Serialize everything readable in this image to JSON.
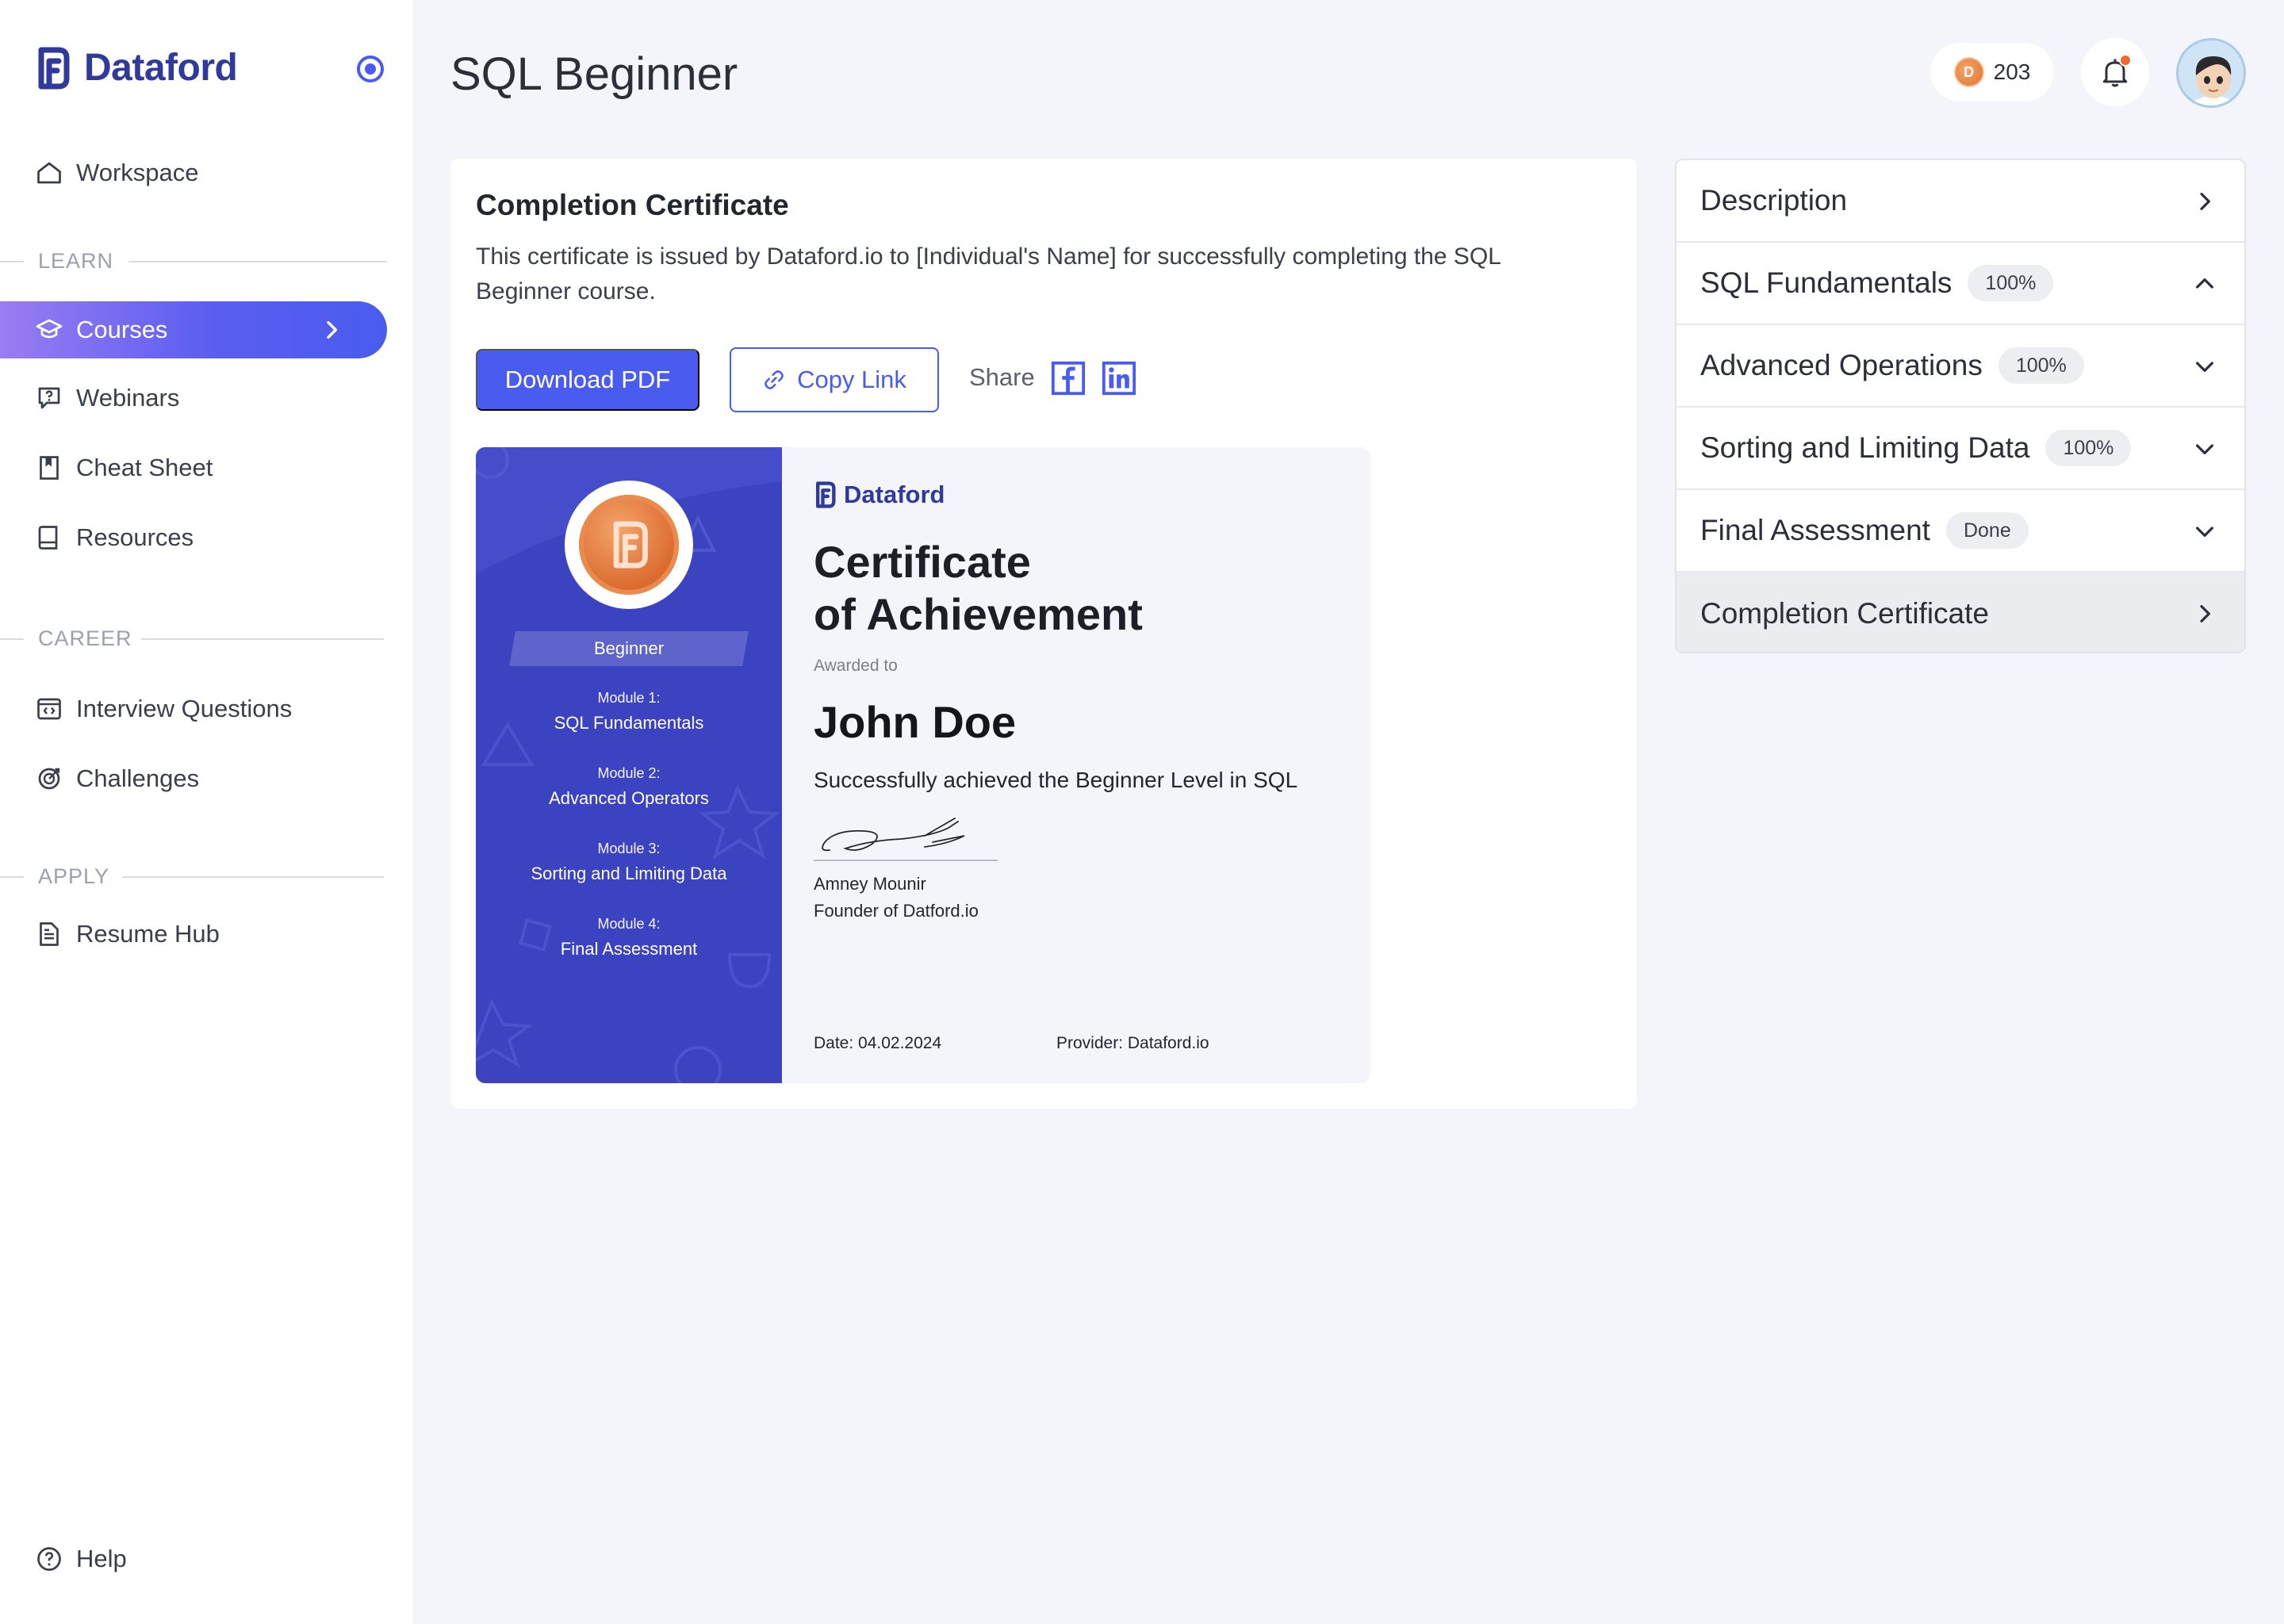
{
  "app": {
    "brand": "Dataford"
  },
  "sidebar": {
    "workspace": "Workspace",
    "sections": {
      "learn": "LEARN",
      "career": "CAREER",
      "apply": "APPLY"
    },
    "learn_items": [
      {
        "label": "Courses",
        "icon": "graduation-cap-icon",
        "active": true
      },
      {
        "label": "Webinars",
        "icon": "chat-question-icon"
      },
      {
        "label": "Cheat Sheet",
        "icon": "bookmark-icon"
      },
      {
        "label": "Resources",
        "icon": "book-icon"
      }
    ],
    "career_items": [
      {
        "label": "Interview Questions",
        "icon": "code-window-icon"
      },
      {
        "label": "Challenges",
        "icon": "target-icon"
      }
    ],
    "apply_items": [
      {
        "label": "Resume Hub",
        "icon": "document-icon"
      }
    ],
    "help": "Help"
  },
  "header": {
    "title": "SQL Beginner",
    "coins": "203",
    "coin_letter": "D"
  },
  "main": {
    "card_title": "Completion Certificate",
    "description": "This certificate is issued by Dataford.io to [Individual's Name] for successfully completing the SQL Beginner course.",
    "download_label": "Download PDF",
    "copy_link_label": "Copy Link",
    "share_label": "Share"
  },
  "certificate": {
    "brand": "Dataford",
    "level": "Beginner",
    "modules": [
      {
        "label": "Module 1:",
        "name": "SQL Fundamentals"
      },
      {
        "label": "Module 2:",
        "name": "Advanced Operators"
      },
      {
        "label": "Module 3:",
        "name": "Sorting and Limiting Data"
      },
      {
        "label": "Module 4:",
        "name": "Final Assessment"
      }
    ],
    "heading_line1": "Certificate",
    "heading_line2": "of Achievement",
    "awarded_to": "Awarded to",
    "recipient": "John Doe",
    "achievement": "Successfully achieved the Beginner Level in SQL",
    "signer_name": "Amney Mounir",
    "signer_title": "Founder of Datford.io",
    "date": "Date: 04.02.2024",
    "provider": "Provider: Dataford.io"
  },
  "accordion": {
    "items": [
      {
        "title": "Description",
        "badge": "",
        "state": "right"
      },
      {
        "title": "SQL Fundamentals",
        "badge": "100%",
        "state": "up"
      },
      {
        "title": "Advanced Operations",
        "badge": "100%",
        "state": "down"
      },
      {
        "title": "Sorting and Limiting Data",
        "badge": "100%",
        "state": "down"
      },
      {
        "title": "Final Assessment",
        "badge": "Done",
        "state": "down"
      },
      {
        "title": "Completion Certificate",
        "badge": "",
        "state": "right",
        "selected": true
      }
    ]
  },
  "colors": {
    "accent": "#4a5cf0",
    "brand": "#2f3a9c",
    "certificate_panel": "#3b43c0",
    "notification": "#ef6a2c"
  }
}
